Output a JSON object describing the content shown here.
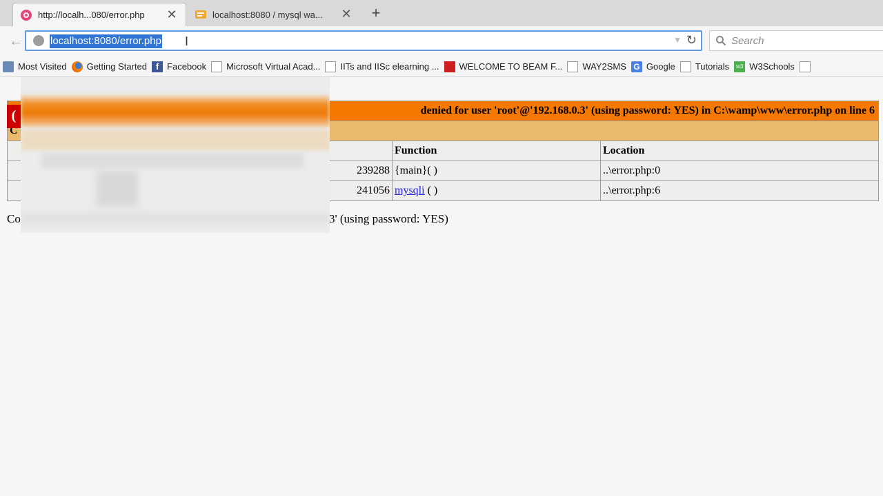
{
  "tabs": [
    {
      "title": "http://localh...080/error.php",
      "active": true
    },
    {
      "title": "localhost:8080 / mysql wa...",
      "active": false
    }
  ],
  "nav": {
    "url": "localhost:8080/error.php",
    "search_placeholder": "Search"
  },
  "bookmarks": [
    {
      "label": "Most Visited",
      "icon": "most-visited-icon"
    },
    {
      "label": "Getting Started",
      "icon": "firefox-icon"
    },
    {
      "label": "Facebook",
      "icon": "facebook-icon"
    },
    {
      "label": "Microsoft Virtual Acad...",
      "icon": "blank-page-icon"
    },
    {
      "label": "IITs and IISc elearning ...",
      "icon": "blank-page-icon"
    },
    {
      "label": "WELCOME TO BEAM F...",
      "icon": "beam-icon"
    },
    {
      "label": "WAY2SMS",
      "icon": "blank-page-icon"
    },
    {
      "label": "Google",
      "icon": "google-icon"
    },
    {
      "label": "Tutorials",
      "icon": "blank-page-icon"
    },
    {
      "label": "W3Schools",
      "icon": "w3schools-icon"
    }
  ],
  "error": {
    "prefix": "(",
    "message": "denied for user 'root'@'192.168.0.3' (using password: YES) in C:\\wamp\\www\\error.php on line 6",
    "stack_label": "C",
    "headers": {
      "function": "Function",
      "location": "Location"
    },
    "rows": [
      {
        "memory": "239288",
        "function": "{main}( )",
        "location": "..\\error.php:0"
      },
      {
        "memory": "241056",
        "function_link": "mysqli",
        "function_suffix": " ( )",
        "location": "..\\error.php:6"
      }
    ],
    "after_prefix": "Co",
    "after_tail": "3' (using password: YES)"
  }
}
